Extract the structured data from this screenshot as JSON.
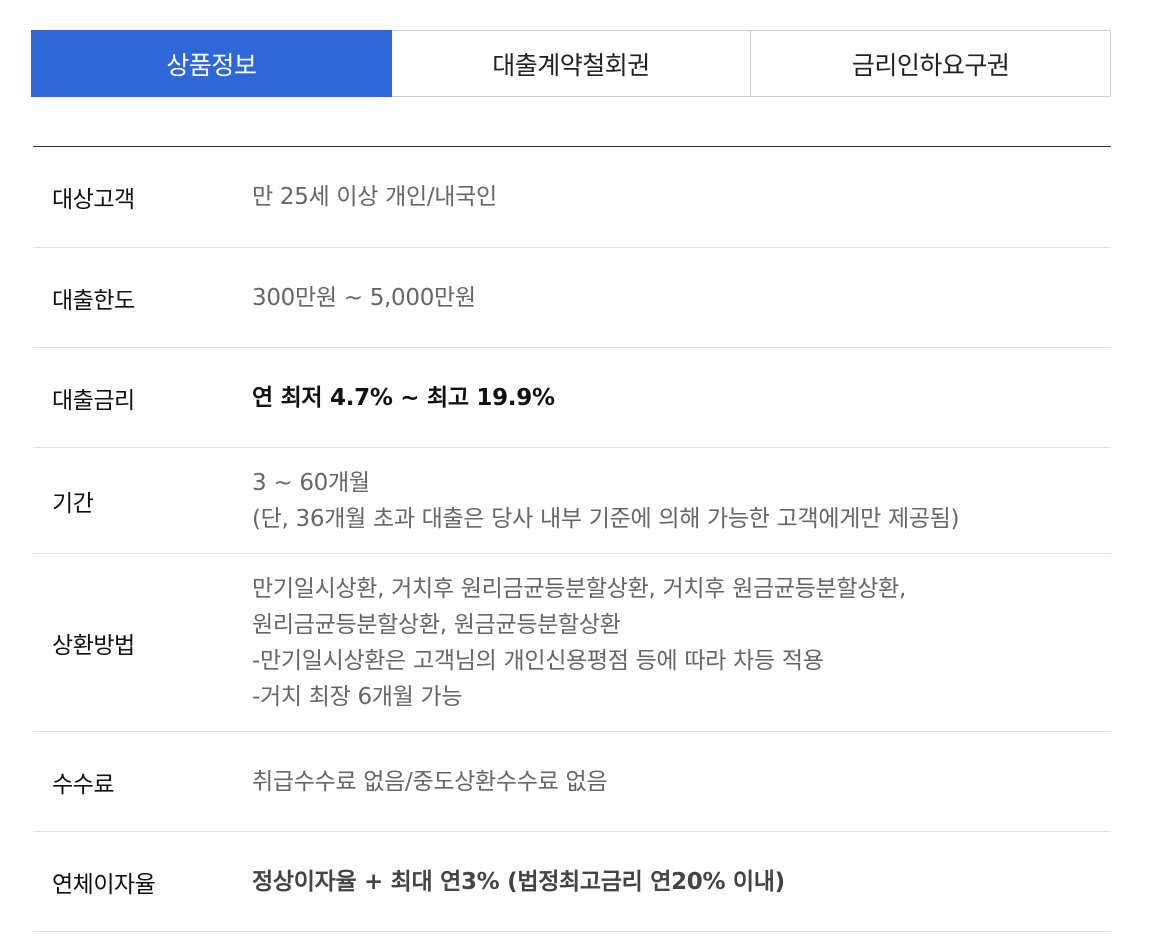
{
  "tabs": [
    {
      "label": "상품정보",
      "active": true
    },
    {
      "label": "대출계약철회권",
      "active": false
    },
    {
      "label": "금리인하요구권",
      "active": false
    }
  ],
  "rows": [
    {
      "label": "대상고객",
      "lines": [
        "만 25세 이상 개인/내국인"
      ]
    },
    {
      "label": "대출한도",
      "lines": [
        "300만원 ~ 5,000만원"
      ]
    },
    {
      "label": "대출금리",
      "lines": [
        "연 최저 4.7% ~ 최고 19.9%"
      ]
    },
    {
      "label": "기간",
      "lines": [
        "3 ~ 60개월",
        "(단, 36개월 초과 대출은 당사 내부 기준에 의해 가능한 고객에게만 제공됨)"
      ]
    },
    {
      "label": "상환방법",
      "lines": [
        "만기일시상환, 거치후 원리금균등분할상환, 거치후 원금균등분할상환,",
        "원리금균등분할상환, 원금균등분할상환",
        "-만기일시상환은 고객님의 개인신용평점 등에 따라 차등 적용",
        "-거치 최장 6개월 가능"
      ]
    },
    {
      "label": "수수료",
      "lines": [
        "취급수수료 없음/중도상환수수료 없음"
      ]
    },
    {
      "label": "연체이자율",
      "lines": [
        "정상이자율 + 최대 연3% (법정최고금리 연20% 이내)"
      ]
    }
  ],
  "colors": {
    "active_tab": "#2d67d8"
  }
}
